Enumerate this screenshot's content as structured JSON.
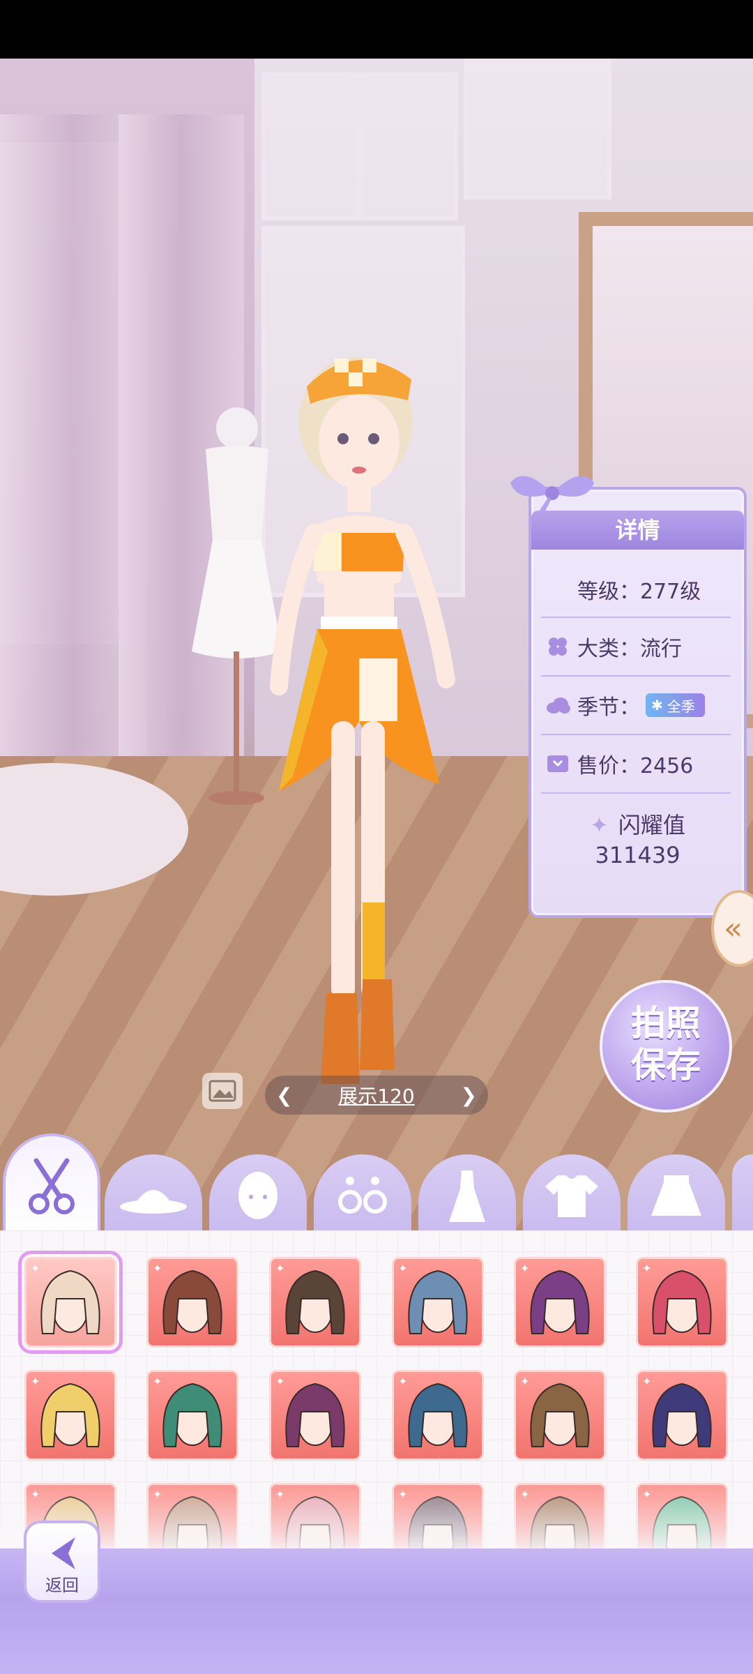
{
  "scene": {
    "showcase_label": "展示120"
  },
  "details": {
    "title": "详情",
    "level": "等级：277级",
    "category": "大类：流行",
    "season_label": "季节：",
    "season_badge": "全季",
    "price": "售价：2456",
    "shine_label": "闪耀值",
    "shine_value": "311439"
  },
  "photo_save": {
    "line1": "拍照",
    "line2": "保存"
  },
  "tabs": [
    {
      "name": "hair",
      "icon": "scissors-icon"
    },
    {
      "name": "hat",
      "icon": "hat-icon"
    },
    {
      "name": "face",
      "icon": "face-icon"
    },
    {
      "name": "earrings",
      "icon": "earrings-icon"
    },
    {
      "name": "dress",
      "icon": "dress-icon"
    },
    {
      "name": "top",
      "icon": "shirt-icon"
    },
    {
      "name": "skirt",
      "icon": "skirt-icon"
    }
  ],
  "hair_colors": [
    [
      "#efd9c5",
      "#8a4a3a",
      "#5a4438",
      "#6e8fb3",
      "#7b3f86",
      "#d8506a"
    ],
    [
      "#f0cf6a",
      "#3f8c77",
      "#7a3a6a",
      "#3f6a8f",
      "#8a6544",
      "#3f3a7a"
    ],
    [
      "#e9c88e",
      "#c7a08a",
      "#e8a9b5",
      "#8f7a86",
      "#b08a70",
      "#7fc7a5"
    ]
  ],
  "back": {
    "label": "返回"
  },
  "colors": {
    "accent": "#9f86e0",
    "card": "#f2746f",
    "panel": "#efe8fb"
  }
}
